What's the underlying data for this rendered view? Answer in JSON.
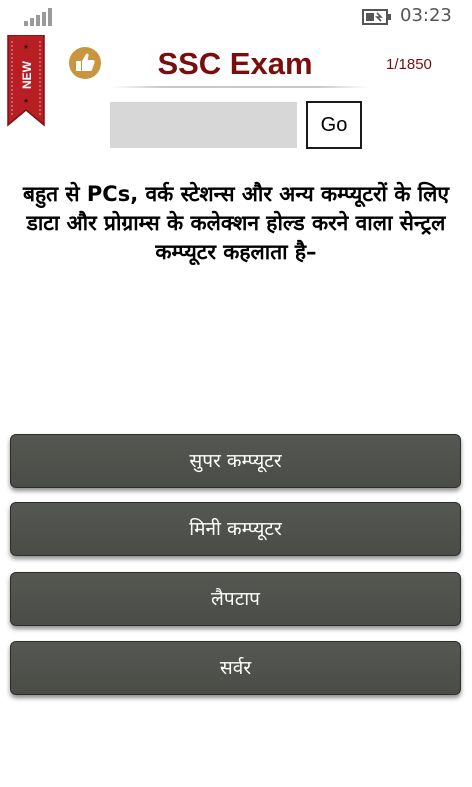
{
  "status_bar": {
    "time": "03:23",
    "signal_icon": "signal-strength-icon",
    "battery_icon": "battery-charging-icon"
  },
  "header": {
    "badge_text": "NEW",
    "like_icon": "thumbs-up-icon",
    "title": "SSC Exam",
    "counter": "1/1850"
  },
  "search": {
    "value": "",
    "go_label": "Go"
  },
  "question": "बहुत से PCs, वर्क स्टेशन्स और अन्य कम्प्यूटरों के लिए डाटा और प्रोग्राम्स के कलेक्शन होल्ड करने वाला सेन्ट्रल कम्प्यूटर कहलाता है–",
  "options": [
    "सुपर कम्प्यूटर",
    "मिनी कम्प्यूटर",
    "लैपटाप",
    "सर्वर"
  ],
  "colors": {
    "title": "#7a0e0e",
    "ribbon": "#b81f24",
    "like_circle": "#c9953f",
    "option_bg": "#4e504b"
  }
}
